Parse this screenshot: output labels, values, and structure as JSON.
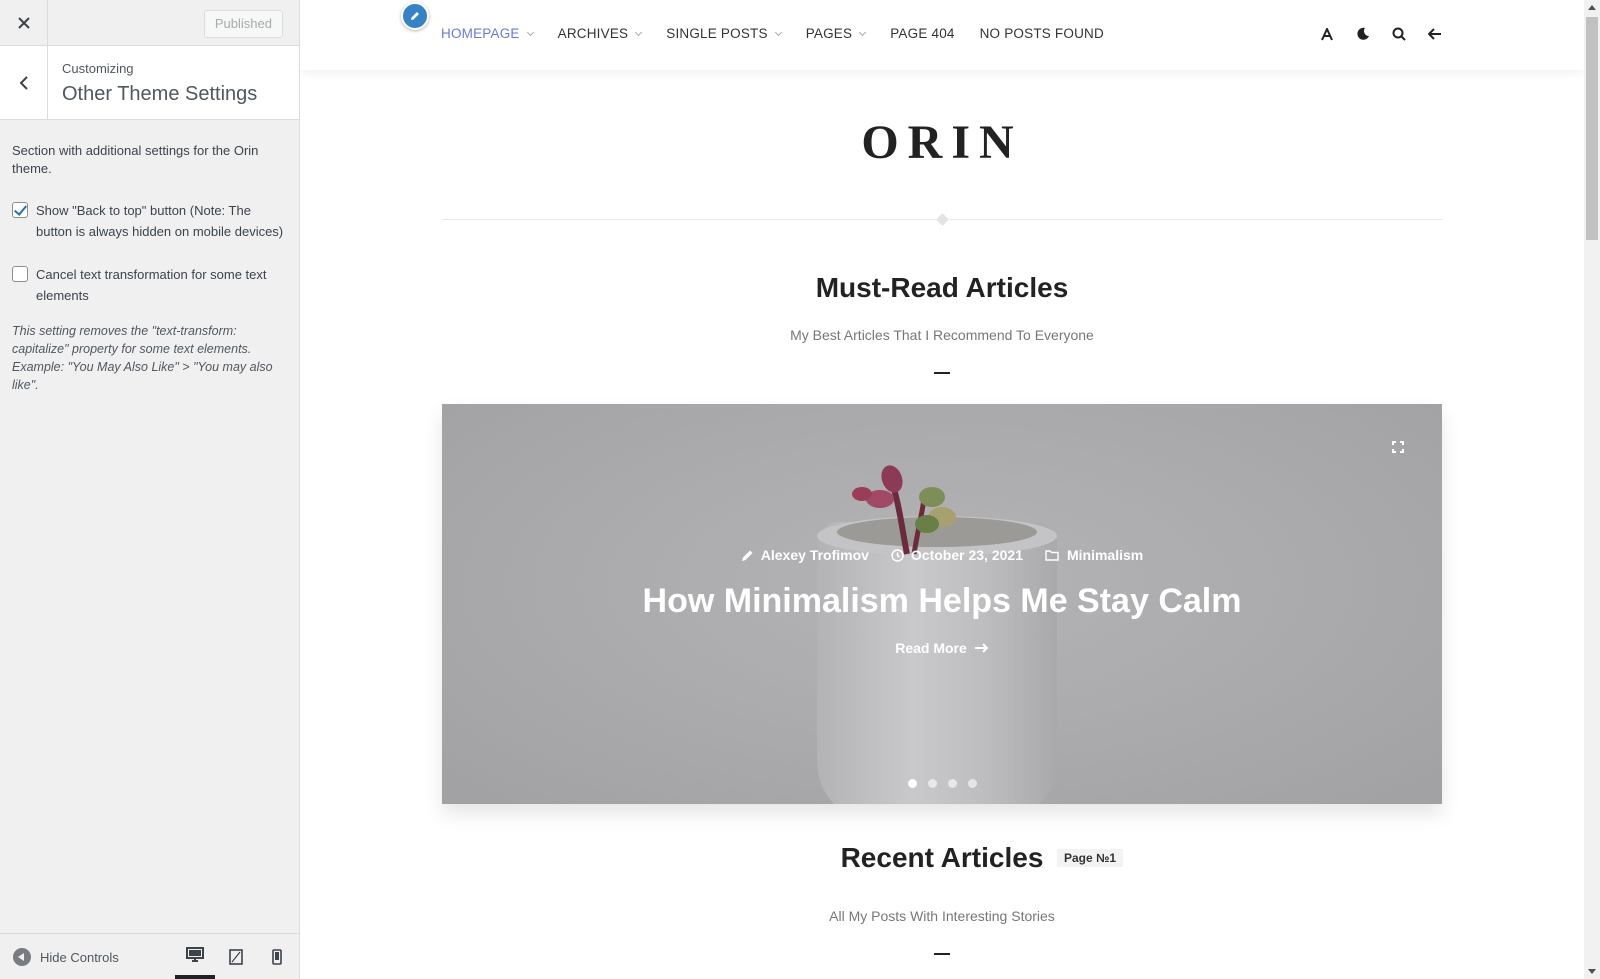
{
  "customizer": {
    "close_icon": "close-icon",
    "published_label": "Published",
    "customizing_label": "Customizing",
    "section_title": "Other Theme Settings",
    "section_description": "Section with additional settings for the Orin theme.",
    "options": [
      {
        "label": "Show \"Back to top\" button (Note: The button is always hidden on mobile devices)",
        "checked": true
      },
      {
        "label": "Cancel text transformation for some text elements",
        "checked": false
      }
    ],
    "note": "This setting removes the \"text-transform: capitalize\" property for some text elements. Example: \"You May Also Like\" > \"You may also like\".",
    "hide_controls_label": "Hide Controls",
    "devices": [
      "desktop",
      "tablet",
      "mobile"
    ],
    "active_device": "desktop"
  },
  "site": {
    "nav": [
      {
        "label": "Homepage",
        "dropdown": true,
        "active": true
      },
      {
        "label": "Archives",
        "dropdown": true
      },
      {
        "label": "Single Posts",
        "dropdown": true
      },
      {
        "label": "Pages",
        "dropdown": true
      },
      {
        "label": "Page 404",
        "dropdown": false
      },
      {
        "label": "No Posts Found",
        "dropdown": false
      }
    ],
    "header_icons": [
      "font-size-icon",
      "dark-mode-icon",
      "search-icon",
      "sidebar-toggle-icon"
    ],
    "title": "ORIN",
    "featured": {
      "title": "Must-Read Articles",
      "subtitle": "My Best Articles That I Recommend To Everyone"
    },
    "slide": {
      "author": "Alexey Trofimov",
      "date": "October 23, 2021",
      "category": "Minimalism",
      "title": "How Minimalism Helps Me Stay Calm",
      "read_more": "Read More",
      "slide_count": 4,
      "active_slide": 1
    },
    "recent": {
      "title": "Recent Articles",
      "badge": "Page №1",
      "subtitle": "All My Posts With Interesting Stories"
    }
  },
  "colors": {
    "accent": "#6a79d8",
    "edit_bubble": "#3582c4",
    "checkbox": "#2271b1"
  }
}
